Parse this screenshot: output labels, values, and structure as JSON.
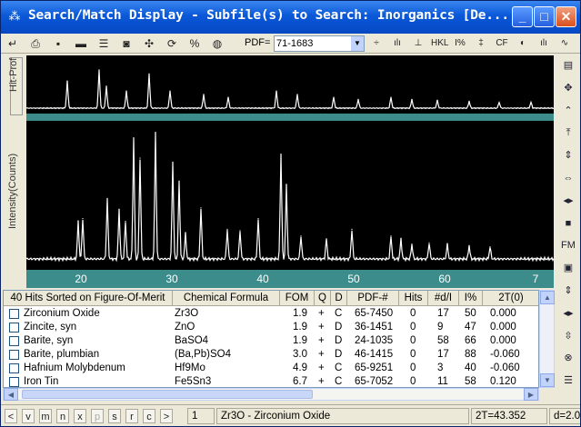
{
  "window": {
    "title": "Search/Match Display - Subfile(s) to Search: Inorganics [De...",
    "icons": [
      "app-icon",
      "minimize-icon",
      "maximize-icon",
      "close-icon"
    ]
  },
  "toolbar": {
    "pdf_label": "PDF=",
    "pdf_value": "71-1683",
    "buttons": [
      {
        "name": "enter-icon",
        "glyph": "↵"
      },
      {
        "name": "print-icon",
        "glyph": "⎙"
      },
      {
        "name": "save-icon",
        "glyph": "▪"
      },
      {
        "name": "printer-icon",
        "glyph": "▬"
      },
      {
        "name": "list-icon",
        "glyph": "☰"
      },
      {
        "name": "camera-icon",
        "glyph": "◙"
      },
      {
        "name": "move-icon",
        "glyph": "✣"
      },
      {
        "name": "refresh-icon",
        "glyph": "⟳"
      },
      {
        "name": "scale-icon",
        "glyph": "%"
      },
      {
        "name": "globe-icon",
        "glyph": "◍"
      }
    ],
    "right_buttons": [
      {
        "name": "spin-icon",
        "glyph": "÷"
      },
      {
        "name": "bars-icon",
        "glyph": "ılı"
      },
      {
        "name": "peak-icon",
        "glyph": "⊥"
      },
      {
        "name": "hkl-icon",
        "glyph": "HKL"
      },
      {
        "name": "percent-icon",
        "glyph": "I%"
      },
      {
        "name": "sticks-icon",
        "glyph": "‡"
      },
      {
        "name": "cf-icon",
        "glyph": "CF"
      },
      {
        "name": "contrast-icon",
        "glyph": "◐"
      },
      {
        "name": "bars2-icon",
        "glyph": "ılı"
      },
      {
        "name": "wave-icon",
        "glyph": "∿"
      }
    ]
  },
  "plot": {
    "hit_label": "Hit-Prof",
    "y_label": "Intensity(Counts)",
    "x_ticks": [
      "20",
      "30",
      "40",
      "50",
      "60",
      "7"
    ]
  },
  "chart_data": {
    "type": "line",
    "xlim": [
      14,
      72
    ],
    "peaks_main": [
      [
        19.7,
        0.28
      ],
      [
        20.2,
        0.3
      ],
      [
        22.9,
        0.45
      ],
      [
        24.2,
        0.37
      ],
      [
        24.9,
        0.28
      ],
      [
        25.8,
        0.9
      ],
      [
        26.5,
        0.75
      ],
      [
        28.2,
        0.94
      ],
      [
        30.1,
        0.72
      ],
      [
        30.8,
        0.58
      ],
      [
        31.5,
        0.19
      ],
      [
        33.2,
        0.38
      ],
      [
        36.1,
        0.22
      ],
      [
        37.5,
        0.21
      ],
      [
        39.5,
        0.3
      ],
      [
        42.0,
        0.78
      ],
      [
        42.6,
        0.55
      ],
      [
        44.2,
        0.17
      ],
      [
        47.0,
        0.15
      ],
      [
        49.8,
        0.22
      ],
      [
        54.1,
        0.17
      ],
      [
        55.2,
        0.15
      ],
      [
        56.4,
        0.11
      ],
      [
        58.3,
        0.12
      ],
      [
        60.3,
        0.11
      ],
      [
        62.7,
        0.1
      ],
      [
        65.0,
        0.09
      ]
    ],
    "peaks_hit": [
      [
        18.5,
        0.55
      ],
      [
        22.0,
        0.78
      ],
      [
        22.8,
        0.45
      ],
      [
        25.0,
        0.35
      ],
      [
        27.5,
        0.7
      ],
      [
        29.8,
        0.35
      ],
      [
        33.5,
        0.28
      ],
      [
        36.2,
        0.22
      ],
      [
        41.5,
        0.35
      ],
      [
        43.8,
        0.28
      ],
      [
        47.8,
        0.22
      ],
      [
        50.5,
        0.18
      ],
      [
        54.1,
        0.22
      ],
      [
        56.4,
        0.18
      ],
      [
        59.2,
        0.16
      ],
      [
        62.7,
        0.14
      ],
      [
        66.0,
        0.12
      ],
      [
        69.5,
        0.12
      ]
    ]
  },
  "table": {
    "header": {
      "title": "40 Hits Sorted on Figure-Of-Merit",
      "formula": "Chemical Formula",
      "fom": "FOM",
      "q": "Q",
      "d": "D",
      "pdf": "PDF-#",
      "hits": "Hits",
      "dl": "#d/I",
      "ipct": "I%",
      "twot": "2T(0)"
    },
    "rows": [
      {
        "name": "Zirconium Oxide",
        "formula": "Zr3O",
        "fom": "1.9",
        "q": "+",
        "d": "C",
        "pdf": "65-7450",
        "hits": "0",
        "dl": "17",
        "ipct": "50",
        "twot": "0.000"
      },
      {
        "name": "Zincite, syn",
        "formula": "ZnO",
        "fom": "1.9",
        "q": "+",
        "d": "D",
        "pdf": "36-1451",
        "hits": "0",
        "dl": "9",
        "ipct": "47",
        "twot": "0.000"
      },
      {
        "name": "Barite, syn",
        "formula": "BaSO4",
        "fom": "1.9",
        "q": "+",
        "d": "D",
        "pdf": "24-1035",
        "hits": "0",
        "dl": "58",
        "ipct": "66",
        "twot": "0.000"
      },
      {
        "name": "Barite, plumbian",
        "formula": "(Ba,Pb)SO4",
        "fom": "3.0",
        "q": "+",
        "d": "D",
        "pdf": "46-1415",
        "hits": "0",
        "dl": "17",
        "ipct": "88",
        "twot": "-0.060"
      },
      {
        "name": "Hafnium Molybdenum",
        "formula": "Hf9Mo",
        "fom": "4.9",
        "q": "+",
        "d": "C",
        "pdf": "65-9251",
        "hits": "0",
        "dl": "3",
        "ipct": "40",
        "twot": "-0.060"
      },
      {
        "name": "Iron Tin",
        "formula": "Fe5Sn3",
        "fom": "6.7",
        "q": "+",
        "d": "C",
        "pdf": "65-7052",
        "hits": "0",
        "dl": "11",
        "ipct": "58",
        "twot": "0.120"
      }
    ]
  },
  "status": {
    "keys": [
      "<",
      "v",
      "m",
      "n",
      "x",
      "p",
      "s",
      "r",
      "c",
      ">"
    ],
    "index": "1",
    "selected": "Zr3O - Zirconium Oxide",
    "twotheta": "2T=43.352",
    "dval": "d=2.0"
  },
  "rightcol": {
    "buttons": [
      {
        "name": "chart-icon",
        "glyph": "▤"
      },
      {
        "name": "move-arrows-icon",
        "glyph": "✥"
      },
      {
        "name": "double-up-icon",
        "glyph": "⌃"
      },
      {
        "name": "top-icon",
        "glyph": "⤒"
      },
      {
        "name": "updown-icon",
        "glyph": "⇕"
      },
      {
        "name": "leftright-icon",
        "glyph": "⇔"
      },
      {
        "name": "expand-icon",
        "glyph": "◂▸"
      },
      {
        "name": "stop-icon",
        "glyph": "■"
      },
      {
        "name": "fm-icon",
        "glyph": "FM"
      },
      {
        "name": "select-icon",
        "glyph": "▣"
      },
      {
        "name": "updown2-icon",
        "glyph": "⇕"
      },
      {
        "name": "expand2-icon",
        "glyph": "◂▸"
      },
      {
        "name": "vert-icon",
        "glyph": "⇳"
      },
      {
        "name": "delete-icon",
        "glyph": "⊗"
      },
      {
        "name": "list2-icon",
        "glyph": "☰"
      }
    ]
  }
}
